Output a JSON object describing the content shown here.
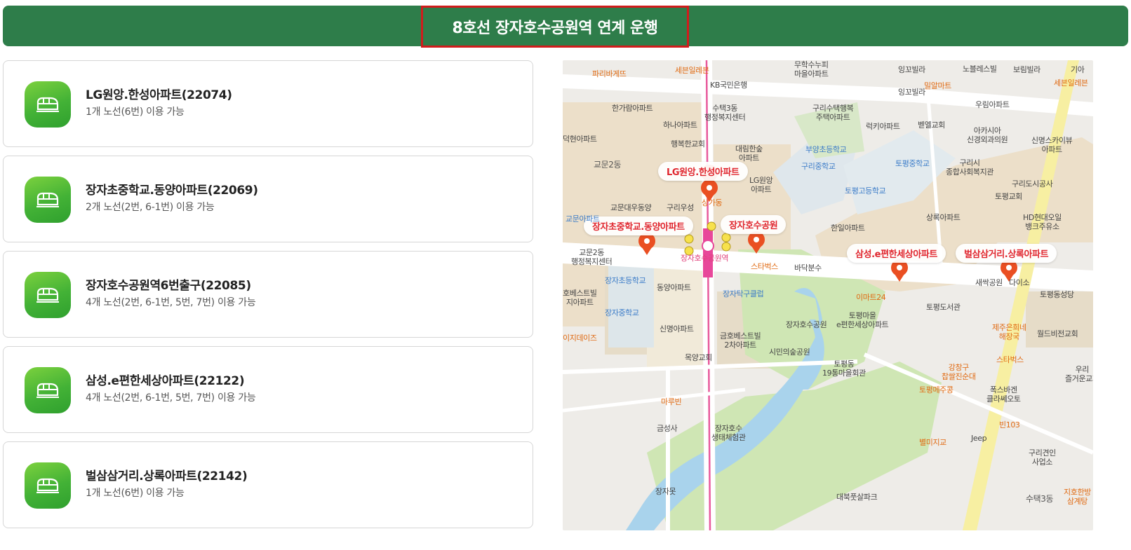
{
  "header": {
    "title": "8호선 장자호수공원역 연계 운행"
  },
  "stops": [
    {
      "name": "LG원앙.한성아파트(22074)",
      "routes": "1개 노선(6번) 이용 가능",
      "icon": "bus-stop-icon"
    },
    {
      "name": "장자초중학교.동양아파트(22069)",
      "routes": "2개 노선(2번, 6-1번) 이용 가능",
      "icon": "bus-stop-icon"
    },
    {
      "name": "장자호수공원역6번출구(22085)",
      "routes": "4개 노선(2번, 6-1번, 5번, 7번) 이용 가능",
      "icon": "bus-stop-icon"
    },
    {
      "name": "삼성.e편한세상아파트(22122)",
      "routes": "4개 노선(2번, 6-1번, 5번, 7번) 이용 가능",
      "icon": "bus-stop-icon"
    },
    {
      "name": "벌삼삼거리.상록아파트(22142)",
      "routes": "1개 노선(6번) 이용 가능",
      "icon": "bus-stop-icon"
    }
  ],
  "map": {
    "markers": [
      {
        "label": "LG원앙.한성아파트"
      },
      {
        "label": "장자초중학교.동양아파트"
      },
      {
        "label": "장자호수공원"
      },
      {
        "label": "삼성.e편한세상아파트"
      },
      {
        "label": "벌삼삼거리.상록아파트"
      }
    ],
    "labels": {
      "parisbaguette": "파리바게뜨",
      "seven_eleven": "세븐일레븐",
      "kb": "KB국민은행",
      "mutak": "무학수누피\n마을아파트",
      "ingkkot1": "잉꼬빌라",
      "ingkkot2": "잉꼬빌라",
      "noble": "노블레스빌",
      "borim": "보림빌라",
      "gia": "기아",
      "milal": "밀알마트",
      "seven_eleven2": "세븐일레븐",
      "urimapt": "우림아파트",
      "hangaram": "한가람아파트",
      "sutaek3": "수택3동\n행정복지센터",
      "guri_sutaek": "구리수택행복\n주택아파트",
      "hana": "하나아파트",
      "lucky": "럭키아파트",
      "bethel": "벧엘교회",
      "acacia": "아카시아\n신경외과의원",
      "sinmyeong_sky": "신명스카이뷰\n아파트",
      "deokhyeon": "덕현아파트",
      "haengbok_church": "행복한교회",
      "daerim": "대림한숲\n아파트",
      "buyang": "부양초등학교",
      "gyomun2": "교문2동",
      "guri_middle": "구리중학교",
      "topyeong_middle": "토평중학교",
      "guri_welfare": "구리시\n종합사회복지관",
      "guri_facility": "구리도시공사",
      "topyeong_high": "토평고등학교",
      "lg_wonang": "LG원앙\n아파트",
      "sanga": "상가동",
      "topyeong_church": "토평교회",
      "gyomun_daewoo": "교문대우동양",
      "guri_woosung": "구리우성",
      "sangnok": "상록아파트",
      "hyundai_oil": "HD현대오일\n뱅크주유소",
      "gyomun_apt": "교문아파트",
      "hanil": "한일아파트",
      "gyomun2_center": "교문2동\n행정복지센터",
      "jangja_elem": "장자초등학교",
      "dongyang": "동양아파트",
      "starbucks1": "스타벅스",
      "badabunsu": "바닥분수",
      "saessak": "새싹공원",
      "daiso": "다이소",
      "topyeong_dong": "토평동성당",
      "jangja_table": "장자탁구클럽",
      "emart24": "이마트24",
      "hobest": "호베스트빌\n지아파트",
      "jangja_middle": "장자중학교",
      "topyeong_library": "토평도서관",
      "topyeong_village": "토평마을\ne편한세상아파트",
      "jangja_park": "장자호수공원",
      "jeju": "제주은희네\n해장국",
      "worldvision": "월드비전교회",
      "ezdays": "이지데이즈",
      "sinmyeong": "신명아파트",
      "geumho": "금호베스트빌\n2차아파트",
      "citizen_forest": "시민의숲공원",
      "starbucks2": "스타벅스",
      "mokyang": "목양교회",
      "topyeong19": "토평동\n19통마을회관",
      "gangchanggu": "강창구\n찹쌀진순대",
      "uri_church": "우리\n즐거운교회",
      "topyeong_meju": "토평메주콩",
      "folks": "폭스바겐\n클라쎄오토",
      "marubin": "마루빈",
      "bin103": "빈103",
      "geumseong": "금성사",
      "jangja_eco": "장자호수\n생태체험관",
      "byeolmi": "별미지교",
      "jeep": "Jeep",
      "guri_dog": "구리견인\n사업소",
      "jangjamot": "장자못",
      "daebuk": "대북풋살파크",
      "sutaek3b": "수택3동",
      "jihohanbang": "지호한방\n삼계탕",
      "station": "장자호수공원역"
    }
  }
}
